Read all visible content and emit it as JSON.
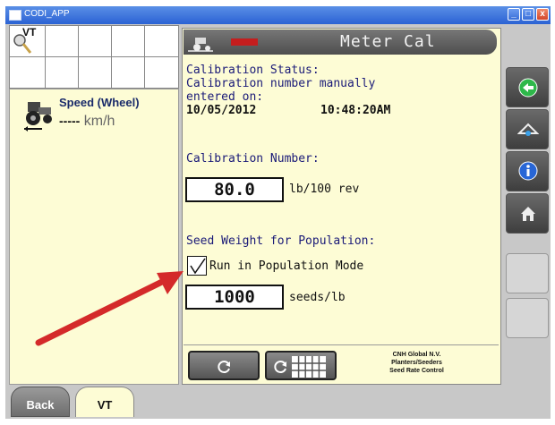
{
  "window": {
    "title": "CODI_APP",
    "controls": [
      "_",
      "□",
      "x"
    ]
  },
  "left": {
    "vt_label": "VT",
    "speed_label": "Speed (Wheel)",
    "speed_value": "-----",
    "speed_unit": "km/h"
  },
  "tabs": {
    "back": "Back",
    "vt": "VT"
  },
  "main": {
    "header_title": "Meter Cal",
    "calibration_status_heading": "Calibration Status:",
    "calibration_status_text_1": "Calibration number manually",
    "calibration_status_text_2": "entered on:",
    "calibration_date": "10/05/2012",
    "calibration_time": "10:48:20AM",
    "calibration_number_heading": "Calibration Number:",
    "calibration_number_value": "80.0",
    "calibration_number_unit": "lb/100 rev",
    "seed_weight_heading": "Seed Weight for Population:",
    "population_mode_label": "Run in Population Mode",
    "population_mode_checked": true,
    "seed_weight_value": "1000",
    "seed_weight_unit": "seeds/lb"
  },
  "footer": {
    "line1": "CNH Global N.V.",
    "line2": "Planters/Seeders",
    "line3": "Seed Rate Control"
  },
  "colors": {
    "arrow": "#d42a2a",
    "panel_bg": "#fdfcd5",
    "header_bg": "#555555",
    "text_blue": "#1a1a78"
  }
}
